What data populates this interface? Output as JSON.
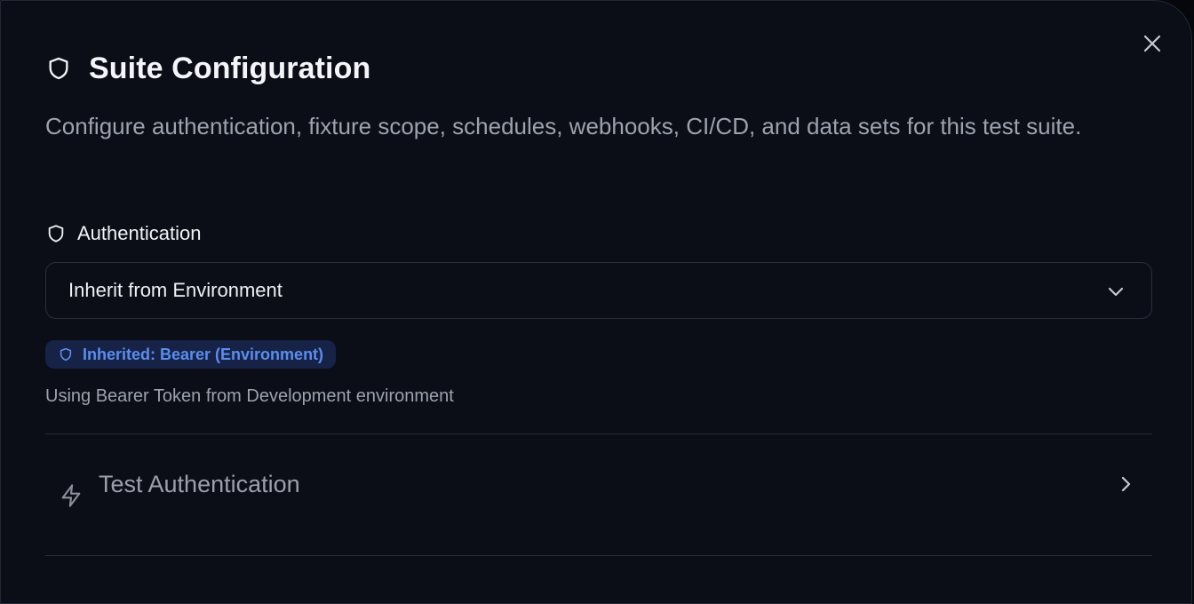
{
  "dialog": {
    "title": "Suite Configuration",
    "title_icon": "shield-icon",
    "description": "Configure authentication, fixture scope, schedules, webhooks, CI/CD, and data sets for this test suite.",
    "close_icon": "close-icon"
  },
  "authentication": {
    "label": "Authentication",
    "icon": "shield-icon",
    "select": {
      "value": "Inherit from Environment",
      "chevron_icon": "chevron-down-icon"
    },
    "badge": {
      "text": "Inherited: Bearer (Environment)",
      "icon": "shield-icon",
      "color": "#5b8def",
      "background": "#172346"
    },
    "hint": "Using Bearer Token from Development environment"
  },
  "test_authentication": {
    "label": "Test Authentication",
    "icon": "lightning-icon",
    "chevron_icon": "chevron-right-icon"
  }
}
